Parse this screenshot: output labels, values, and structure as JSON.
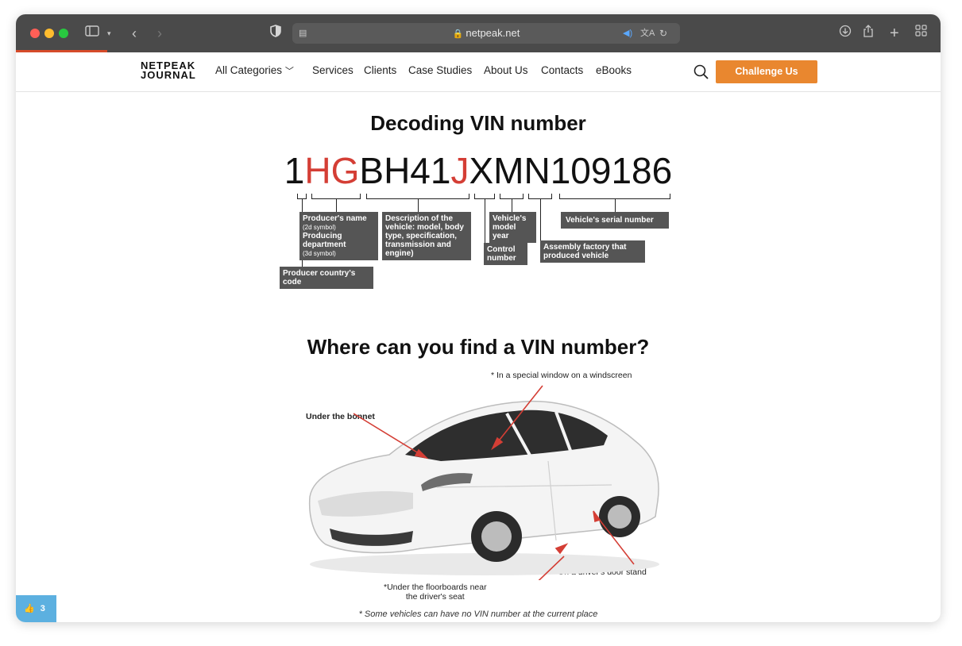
{
  "browser": {
    "url": "netpeak.net",
    "colors": {
      "titlebar": "#4a4a4a",
      "close": "#ff5f57",
      "minimize": "#febc2e",
      "maximize": "#28c840",
      "progress": "#d64b2a"
    }
  },
  "site": {
    "logo_line1": "NETPEAK",
    "logo_line2": "JOURNAL",
    "nav": [
      "All Categories",
      "Services",
      "Clients",
      "Case Studies",
      "About Us",
      "Contacts",
      "eBooks"
    ],
    "cta": "Challenge Us",
    "accent": "#e9872f"
  },
  "infographic": {
    "vin_title": "Decoding VIN number",
    "vin_parts": [
      {
        "text": "1",
        "red": false
      },
      {
        "text": "HG",
        "red": true
      },
      {
        "text": "BH41",
        "red": false
      },
      {
        "text": "J",
        "red": true
      },
      {
        "text": "XMN109186",
        "red": false
      }
    ],
    "labels": {
      "producer_name": "Producer's name",
      "producer_name_note": "(2d symbol)",
      "producing_dept": "Producing department",
      "producing_dept_note": "(3d symbol)",
      "description": "Description of the vehicle: model, body type, specification, transmission and engine)",
      "model_year": "Vehicle's model year",
      "serial": "Vehicle's serial number",
      "assembly": "Assembly factory that produced vehicle",
      "control": "Control number",
      "country": "Producer country's code"
    },
    "find_title": "Where can you find a VIN number?",
    "locations": {
      "windscreen": "* In a special window on a windscreen",
      "bonnet": "Under the bonnet",
      "door": "*On a driver's door stand",
      "floor_line1": "*Under the floorboards near",
      "floor_line2": "the driver's seat"
    },
    "footnote": "* Some vehicles can have no VIN number at the current place"
  },
  "like_count": "3"
}
